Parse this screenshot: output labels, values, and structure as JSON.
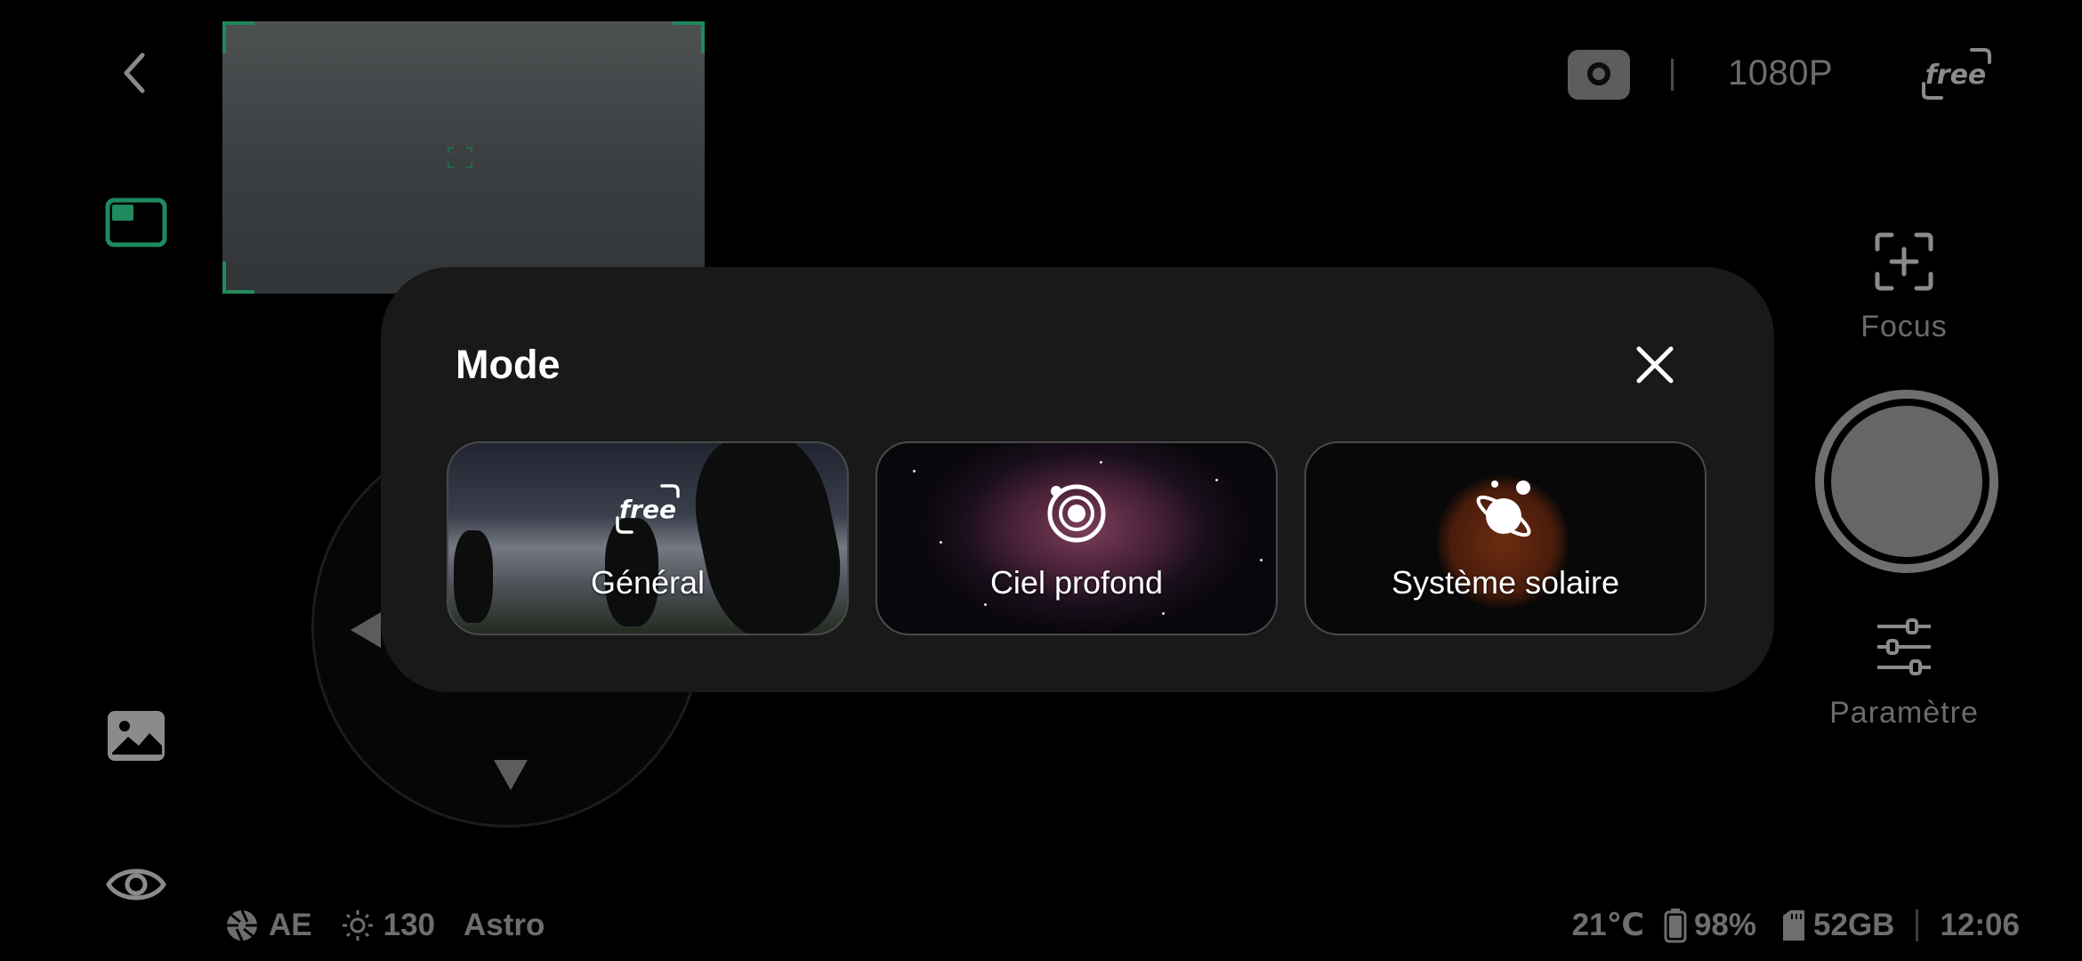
{
  "preview": {
    "label": "preview-frame"
  },
  "top_bar": {
    "resolution": "1080P",
    "badge": "free"
  },
  "right_rail": {
    "focus_label": "Focus",
    "settings_label": "Paramètre"
  },
  "status_bar": {
    "exposure_mode": "AE",
    "brightness": "130",
    "scene": "Astro",
    "temperature": "21℃",
    "battery": "98%",
    "storage": "52GB",
    "time": "12:06"
  },
  "modal": {
    "title": "Mode",
    "cards": [
      {
        "label": "Général",
        "icon": "free-icon"
      },
      {
        "label": "Ciel profond",
        "icon": "deep-sky-icon"
      },
      {
        "label": "Système solaire",
        "icon": "planet-icon"
      }
    ]
  },
  "colors": {
    "accent_green": "#1f8a5e",
    "modal_bg": "#191919",
    "muted_text": "#6e6e6e"
  }
}
